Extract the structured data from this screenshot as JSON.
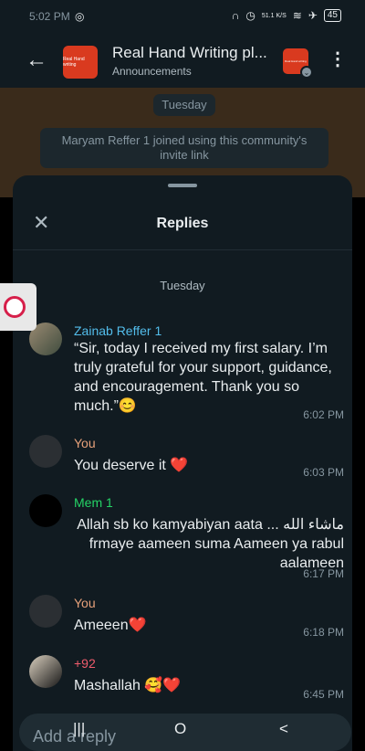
{
  "status_bar": {
    "time": "5:02 PM",
    "network_speed": "51.1\nK/S",
    "battery": "45",
    "icons": [
      "whatsapp-icon",
      "headphones-icon",
      "alarm-icon",
      "wifi-icon",
      "airplane-icon",
      "battery-icon"
    ]
  },
  "header": {
    "back_icon": "arrow-left-icon",
    "group_avatar_text": "Real Hand writing",
    "title": "Real Hand Writing pl...",
    "subtitle": "Announcements",
    "community_icon_text": "Real Hand writing",
    "menu_icon": "vertical-dots-icon"
  },
  "chat": {
    "day_label": "Tuesday",
    "system_message": "Maryam Reffer 1 joined using this community's invite link"
  },
  "replies": {
    "title": "Replies",
    "day_label": "Tuesday",
    "messages": [
      {
        "sender": "Zainab Reffer 1",
        "sender_color": "#53bdeb",
        "text": "“Sir, today I received my first salary. I’m truly grateful for your support, guidance, and encouragement. Thank you so much.”😊",
        "time": "6:02 PM"
      },
      {
        "sender": "You",
        "sender_color": "#e7a17a",
        "text": "You deserve it ❤️",
        "time": "6:03 PM"
      },
      {
        "sender": "Mem 1",
        "sender_color": "#25d366",
        "text": "Allah sb ko kamyabiyan aata ... ماشاء الله frmaye aameen suma Aameen ya rabul aalameen",
        "time": "6:17 PM"
      },
      {
        "sender": "You",
        "sender_color": "#e7a17a",
        "text": "Ameeen❤️",
        "time": "6:18 PM"
      },
      {
        "sender": "+92",
        "sender_color": "#f15c6d",
        "text": "Mashallah 🥰❤️",
        "time": "6:45 PM"
      }
    ]
  },
  "input": {
    "placeholder": "Add a reply"
  },
  "navigation": {
    "recent": "|||",
    "home": "O",
    "back": "<"
  },
  "colors": {
    "background": "#111b21",
    "text": "#e9edef",
    "muted": "#8696a0",
    "brand": "#d93a1f"
  }
}
